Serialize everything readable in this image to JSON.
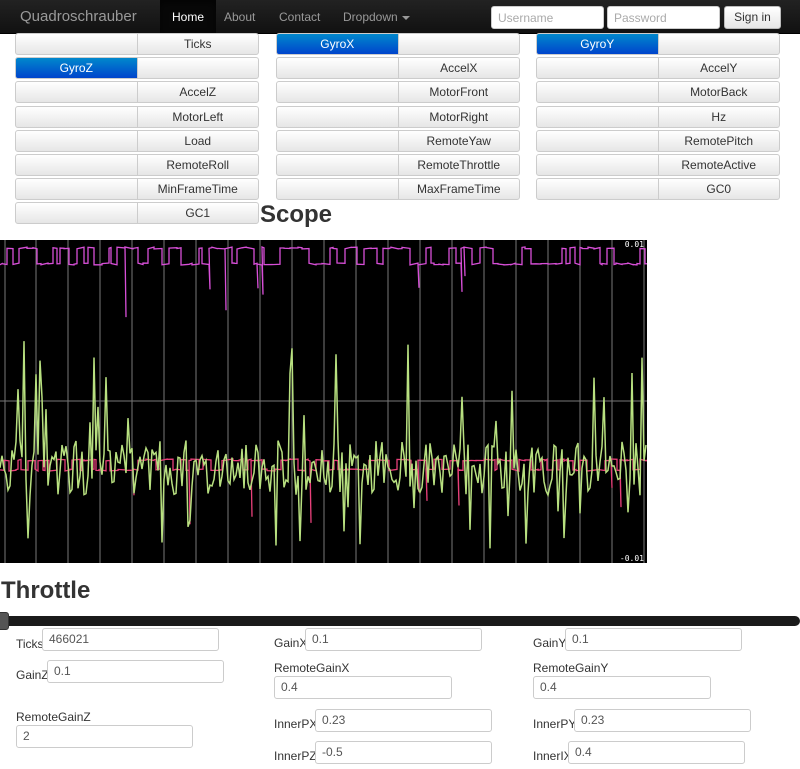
{
  "navbar": {
    "brand": "Quadroschrauber",
    "items": [
      "Home",
      "About",
      "Contact",
      "Dropdown"
    ],
    "username_placeholder": "Username",
    "password_placeholder": "Password",
    "signin_label": "Sign in"
  },
  "channels": {
    "col1": [
      {
        "left": "",
        "right": "Ticks"
      },
      {
        "left": "GyroZ",
        "right": ""
      },
      {
        "left": "",
        "right": "AccelZ"
      },
      {
        "left": "",
        "right": "MotorLeft"
      },
      {
        "left": "",
        "right": "Load"
      },
      {
        "left": "",
        "right": "RemoteRoll"
      },
      {
        "left": "",
        "right": "MinFrameTime"
      },
      {
        "left": "",
        "right": "GC1"
      }
    ],
    "col2": [
      {
        "left": "GyroX",
        "right": ""
      },
      {
        "left": "",
        "right": "AccelX"
      },
      {
        "left": "",
        "right": "MotorFront"
      },
      {
        "left": "",
        "right": "MotorRight"
      },
      {
        "left": "",
        "right": "RemoteYaw"
      },
      {
        "left": "",
        "right": "RemoteThrottle"
      },
      {
        "left": "",
        "right": "MaxFrameTime"
      }
    ],
    "col3": [
      {
        "left": "GyroY",
        "right": ""
      },
      {
        "left": "",
        "right": "AccelY"
      },
      {
        "left": "",
        "right": "MotorBack"
      },
      {
        "left": "",
        "right": "Hz"
      },
      {
        "left": "",
        "right": "RemotePitch"
      },
      {
        "left": "",
        "right": "RemoteActive"
      },
      {
        "left": "",
        "right": "GC0"
      }
    ]
  },
  "scope": {
    "title": "Scope",
    "top_label": "0.01",
    "bottom_label": "-0.01",
    "colors": {
      "magenta": "#d84fd8",
      "pink": "#e8407a",
      "green": "#b8e080",
      "grid": "#777777"
    }
  },
  "throttle": {
    "title": "Throttle",
    "value": 0
  },
  "params": {
    "ticks": {
      "label": "Ticks",
      "value": "466021"
    },
    "gainx": {
      "label": "GainX",
      "value": "0.1"
    },
    "gainy": {
      "label": "GainY",
      "value": "0.1"
    },
    "gainz": {
      "label": "GainZ",
      "value": "0.1"
    },
    "remotegainx": {
      "label": "RemoteGainX",
      "value": "0.4"
    },
    "remotegainy": {
      "label": "RemoteGainY",
      "value": "0.4"
    },
    "remotegainz": {
      "label": "RemoteGainZ",
      "value": "2"
    },
    "innerpx": {
      "label": "InnerPX",
      "value": "0.23"
    },
    "innerpy": {
      "label": "InnerPY",
      "value": "0.23"
    },
    "innerpz": {
      "label": "InnerPZ",
      "value": "-0.5"
    },
    "innerix": {
      "label": "InnerIX",
      "value": "0.4"
    }
  }
}
